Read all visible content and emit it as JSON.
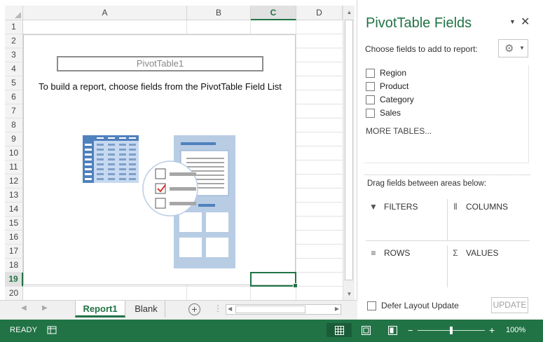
{
  "sheet": {
    "columns": [
      {
        "label": "A",
        "active": false
      },
      {
        "label": "B",
        "active": false
      },
      {
        "label": "C",
        "active": true
      },
      {
        "label": "D",
        "active": false
      }
    ],
    "rows": [
      "1",
      "2",
      "3",
      "4",
      "5",
      "6",
      "7",
      "8",
      "9",
      "10",
      "11",
      "12",
      "13",
      "14",
      "15",
      "16",
      "17",
      "18",
      "19",
      "20"
    ],
    "active_row": "19"
  },
  "pivot": {
    "name": "PivotTable1",
    "hint": "To build a report, choose fields from the PivotTable Field List"
  },
  "tabs": [
    {
      "label": "Report1",
      "active": true
    },
    {
      "label": "Blank",
      "active": false
    }
  ],
  "pane": {
    "title": "PivotTable Fields",
    "choose_label": "Choose fields to add to report:",
    "fields": [
      "Region",
      "Product",
      "Category",
      "Sales"
    ],
    "more_tables": "MORE TABLES...",
    "drag_label": "Drag fields between areas below:",
    "areas": {
      "filters": "FILTERS",
      "columns": "COLUMNS",
      "rows": "ROWS",
      "values": "VALUES"
    },
    "defer_label": "Defer Layout Update",
    "update_label": "UPDATE"
  },
  "status": {
    "text": "READY",
    "zoom": "100%"
  },
  "colors": {
    "accent": "#217346",
    "illustration_blue": "#4f81bd",
    "illustration_light": "#c6d9f1"
  }
}
